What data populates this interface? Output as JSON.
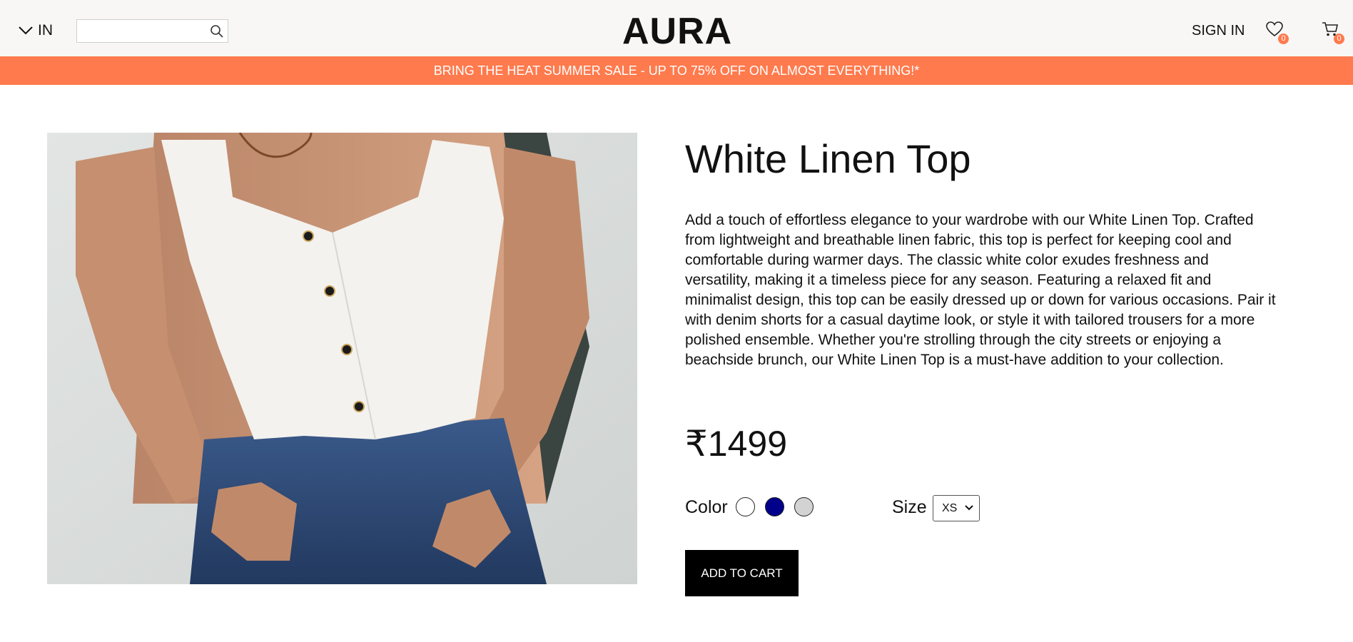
{
  "header": {
    "region_label": "IN",
    "search_placeholder": "",
    "logo": "AURA",
    "sign_in_label": "SIGN IN",
    "wishlist_count": "0",
    "cart_count": "0"
  },
  "promo_banner": "BRING THE HEAT SUMMER SALE - UP TO 75% OFF ON ALMOST EVERYTHING!*",
  "product": {
    "title": "White Linen Top",
    "description": "Add a touch of effortless elegance to your wardrobe with our White Linen Top. Crafted from lightweight and breathable linen fabric, this top is perfect for keeping cool and comfortable during warmer days. The classic white color exudes freshness and versatility, making it a timeless piece for any season. Featuring a relaxed fit and minimalist design, this top can be easily dressed up or down for various occasions. Pair it with denim shorts for a casual daytime look, or style it with tailored trousers for a more polished ensemble. Whether you're strolling through the city streets or enjoying a beachside brunch, our White Linen Top is a must-have addition to your collection.",
    "price": "₹1499",
    "color_label": "Color",
    "color_options": [
      "#ffffff",
      "#00008b",
      "#d3d3d3"
    ],
    "size_label": "Size",
    "size_selected": "XS",
    "add_to_cart_label": "ADD TO CART"
  },
  "colors": {
    "accent": "#ff7a4d",
    "header_bg": "#f8f7f5",
    "button_bg": "#000000"
  }
}
